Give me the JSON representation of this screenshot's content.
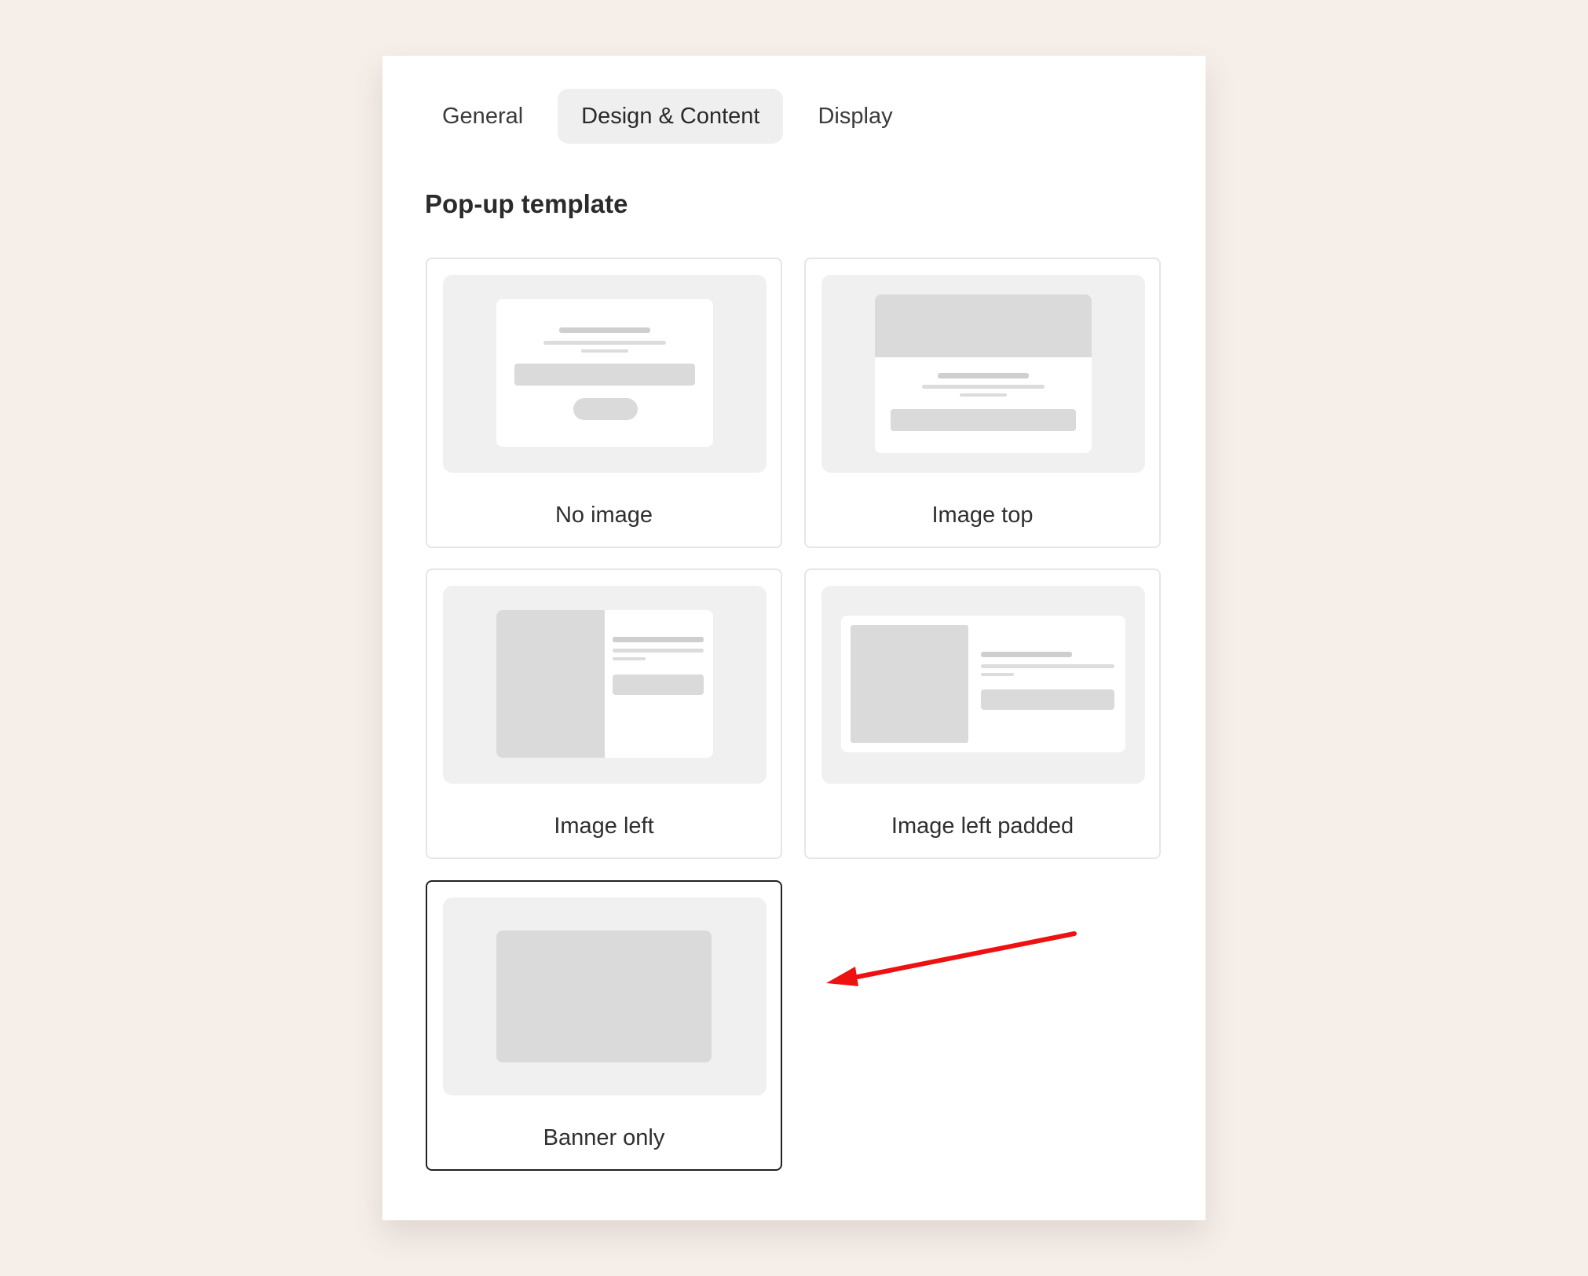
{
  "tabs": [
    {
      "label": "General",
      "active": false
    },
    {
      "label": "Design & Content",
      "active": true
    },
    {
      "label": "Display",
      "active": false
    }
  ],
  "section": {
    "title": "Pop-up template"
  },
  "templates": [
    {
      "label": "No image",
      "selected": false
    },
    {
      "label": "Image top",
      "selected": false
    },
    {
      "label": "Image left",
      "selected": false
    },
    {
      "label": "Image left padded",
      "selected": false
    },
    {
      "label": "Banner only",
      "selected": true
    }
  ],
  "colors": {
    "page_background": "#f5eee9",
    "selected_border": "#222222",
    "annotation_arrow": "#ee1111"
  }
}
